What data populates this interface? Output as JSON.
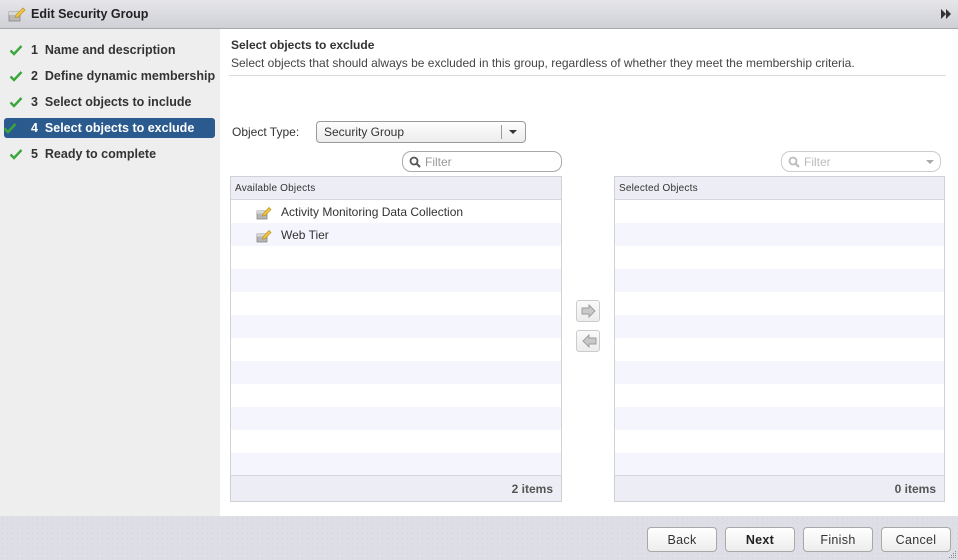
{
  "window": {
    "title": "Edit Security Group",
    "title_icon": "edit-group-icon",
    "expand_icon": "double-chevron-right-icon"
  },
  "steps": [
    {
      "number": "1",
      "label": "Name and description",
      "completed": true,
      "active": false
    },
    {
      "number": "2",
      "label": "Define dynamic membership",
      "completed": true,
      "active": false
    },
    {
      "number": "3",
      "label": "Select objects to include",
      "completed": true,
      "active": false
    },
    {
      "number": "4",
      "label": "Select objects to exclude",
      "completed": true,
      "active": true
    },
    {
      "number": "5",
      "label": "Ready to complete",
      "completed": true,
      "active": false
    }
  ],
  "page": {
    "heading": "Select objects to exclude",
    "description": "Select objects that should always be excluded in this group, regardless of whether they meet the membership criteria."
  },
  "object_type": {
    "label": "Object Type:",
    "selected": "Security Group"
  },
  "available": {
    "filter_placeholder": "Filter",
    "header": "Available Objects",
    "items": [
      {
        "name": "Activity Monitoring Data Collection",
        "icon": "security-group-icon"
      },
      {
        "name": "Web Tier",
        "icon": "security-group-icon"
      }
    ],
    "count_label": "2 items"
  },
  "selected": {
    "filter_placeholder": "Filter",
    "header": "Selected Objects",
    "items": [],
    "count_label": "0 items"
  },
  "move_buttons": {
    "add_icon": "arrow-right-icon",
    "remove_icon": "arrow-left-icon"
  },
  "footer": {
    "back": "Back",
    "next": "Next",
    "finish": "Finish",
    "cancel": "Cancel"
  },
  "colors": {
    "active_step_bg": "#2a5a8e",
    "check_green": "#3aa73a"
  }
}
